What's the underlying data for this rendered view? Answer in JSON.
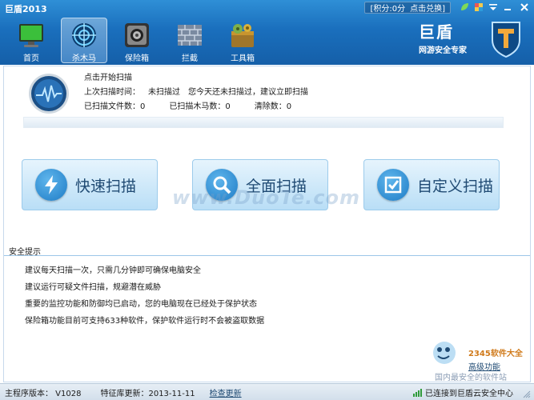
{
  "window": {
    "title": "巨盾2013",
    "points_text": "[积分:0分",
    "exchange_link": "点击兑换]"
  },
  "nav": {
    "items": [
      {
        "label": "首页",
        "icon": "monitor-icon"
      },
      {
        "label": "杀木马",
        "icon": "crosshair-icon"
      },
      {
        "label": "保险箱",
        "icon": "safe-icon"
      },
      {
        "label": "拦截",
        "icon": "firewall-icon"
      },
      {
        "label": "工具箱",
        "icon": "toolbox-icon"
      }
    ],
    "active_index": 1
  },
  "brand": {
    "name": "巨盾",
    "subtitle": "网游安全专家"
  },
  "scan": {
    "start_label": "点击开始扫描",
    "last_scan_label": "上次扫描时间：",
    "last_scan_value": "未扫描过",
    "advice": "您今天还未扫描过，建议立即扫描",
    "files_scanned": "已扫描文件数：0",
    "trojans_scanned": "已扫描木马数：0",
    "cleared": "清除数：0",
    "progress": 0
  },
  "buttons": {
    "quick": "快速扫描",
    "full": "全面扫描",
    "custom": "自定义扫描"
  },
  "watermark": "www.DuoTe.com",
  "tips": {
    "title": "安全提示",
    "items": [
      "建议每天扫描一次，只需几分钟即可确保电脑安全",
      "建议运行可疑文件扫描，规避潜在威胁",
      "重要的监控功能和防御均已启动，您的电脑现在已经处于保护状态",
      "保险箱功能目前可支持633种软件，保护软件运行时不会被盗取数据"
    ]
  },
  "corner": {
    "brand_text": "2345软件大全",
    "link": "高级功能",
    "sub": "国内最安全的软件站"
  },
  "status": {
    "version": "主程序版本： V1028",
    "db_update": "特征库更新：2013-11-11",
    "check_update": "检查更新",
    "cloud": "已连接到巨盾云安全中心"
  },
  "colors": {
    "header_blue": "#1a6fbd",
    "button_text": "#1f4a73",
    "button_icon": "#1e7cc6"
  }
}
